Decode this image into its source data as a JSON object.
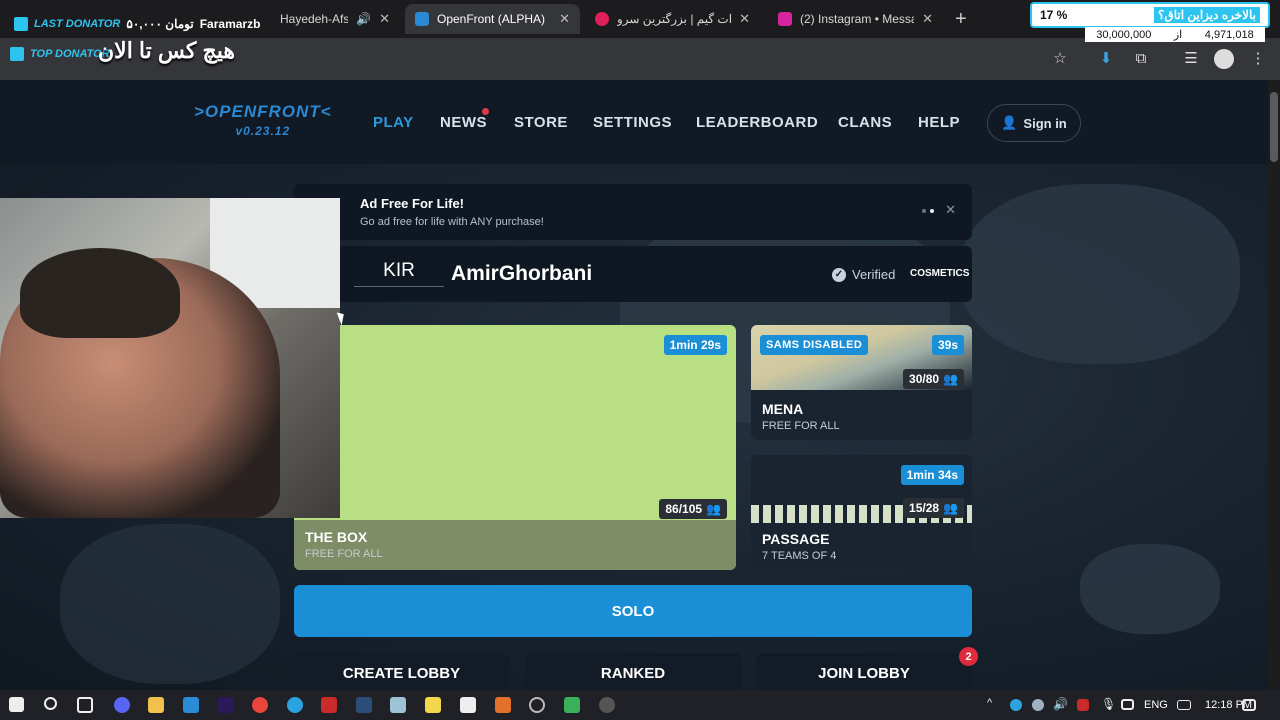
{
  "browser": {
    "tabs": [
      {
        "title": "Hayedeh-Afs",
        "color": "#c23c54"
      },
      {
        "title": "OpenFront (ALPHA)",
        "color": "#2a88d4"
      },
      {
        "title": "آپارات گیم | بزرگترین سرو",
        "color": "#df1f5a"
      },
      {
        "title": "(2) Instagram • Messag",
        "color": "#d6249f"
      }
    ],
    "close_glyph": "✕",
    "new_tab_glyph": "+",
    "toolbar_icons": [
      "star-icon",
      "extension-download-icon",
      "puzzle-icon",
      "reading-list-icon",
      "profile-avatar",
      "menu-dots-icon"
    ]
  },
  "overlay": {
    "last_donator_tag": "LAST DONATOR",
    "last_donator_amount": "۵۰,۰۰۰ تومان",
    "last_donator_name": "Faramarzb",
    "top_donator_tag": "TOP DONATOR",
    "top_donator_text": "هیچ کس تا الان",
    "goal_percent": "17 %",
    "goal_title": "بالاخره دیزاین اتاق؟",
    "goal_target": "30,000,000",
    "goal_of": "از",
    "goal_current": "4,971,018"
  },
  "game": {
    "logo": ">OPENFRONT<",
    "version": "v0.23.12",
    "nav": [
      "PLAY",
      "NEWS",
      "STORE",
      "SETTINGS",
      "LEADERBOARD",
      "CLANS",
      "HELP"
    ],
    "signin": "Sign in",
    "promo_title": "Ad Free For Life!",
    "promo_sub": "Go ad free for life with ANY purchase!",
    "promo_close": "✕",
    "clan_tag": "KIR",
    "username": "AmirGhorbani",
    "verified": "Verified",
    "cosmetics": "COSMETICS",
    "lobbies": {
      "main": {
        "name": "THE BOX",
        "mode": "FREE FOR ALL",
        "time": "1min 29s",
        "players": "86/105"
      },
      "mena": {
        "name": "MENA",
        "mode": "FREE FOR ALL",
        "time": "39s",
        "players": "30/80",
        "badge": "SAMS DISABLED"
      },
      "passage": {
        "name": "PASSAGE",
        "mode": "7 TEAMS OF 4",
        "time": "1min 34s",
        "players": "15/28"
      }
    },
    "solo": "SOLO",
    "create_lobby": "CREATE LOBBY",
    "ranked": "RANKED",
    "join_lobby": "JOIN LOBBY",
    "notif_count": "2"
  },
  "taskbar": {
    "lang": "ENG",
    "time": "12:18 PM"
  }
}
